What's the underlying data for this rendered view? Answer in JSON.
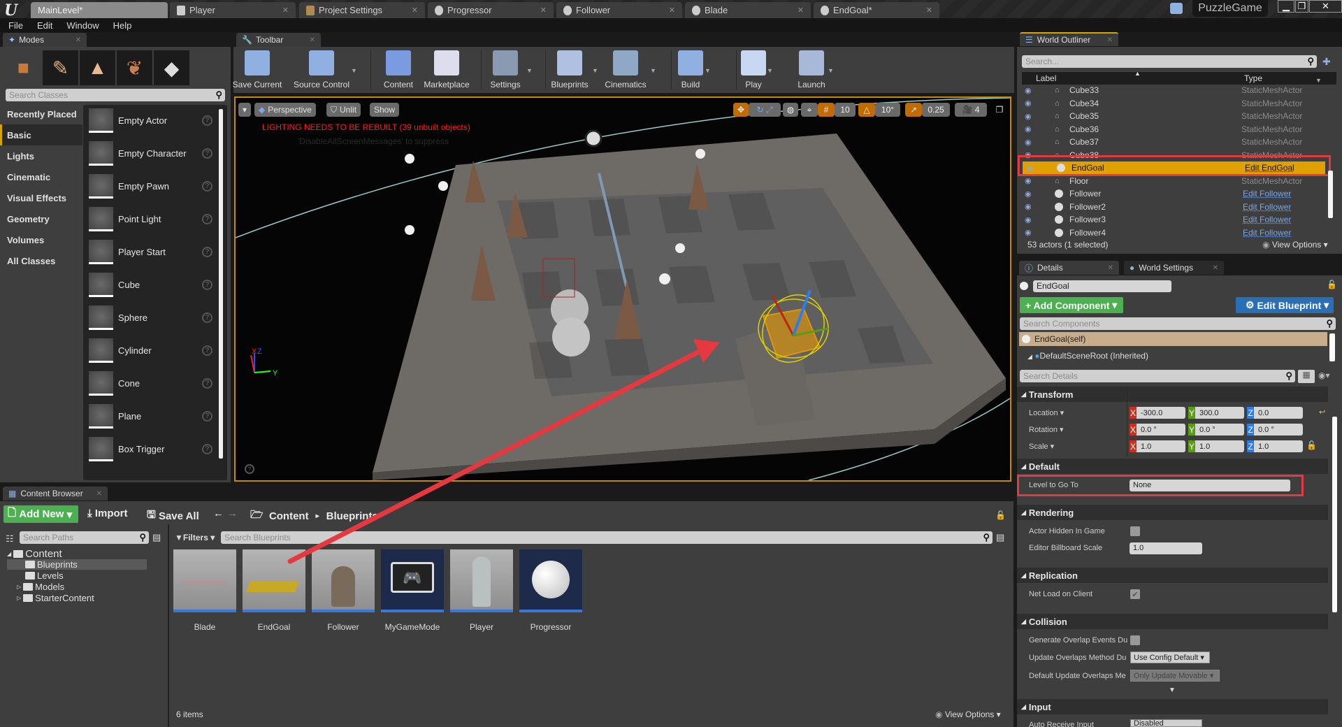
{
  "titlebar": {
    "tabs": [
      {
        "label": "MainLevel*",
        "active": true
      },
      {
        "label": "Player"
      },
      {
        "label": "Project Settings"
      },
      {
        "label": "Progressor"
      },
      {
        "label": "Follower"
      },
      {
        "label": "Blade"
      },
      {
        "label": "EndGoal*"
      }
    ],
    "project_name": "PuzzleGame",
    "window_buttons": {
      "minimize": "▁",
      "restore": "❐",
      "close": "✕"
    }
  },
  "menu": [
    "File",
    "Edit",
    "Window",
    "Help"
  ],
  "modes": {
    "tab_label": "Modes",
    "mode_icons": [
      "place-mode-icon",
      "paint-mode-icon",
      "landscape-mode-icon",
      "foliage-mode-icon",
      "geometry-mode-icon"
    ],
    "search_placeholder": "Search Classes",
    "categories": [
      {
        "label": "Recently Placed"
      },
      {
        "label": "Basic",
        "selected": true
      },
      {
        "label": "Lights"
      },
      {
        "label": "Cinematic"
      },
      {
        "label": "Visual Effects"
      },
      {
        "label": "Geometry"
      },
      {
        "label": "Volumes"
      },
      {
        "label": "All Classes"
      }
    ],
    "items": [
      "Empty Actor",
      "Empty Character",
      "Empty Pawn",
      "Point Light",
      "Player Start",
      "Cube",
      "Sphere",
      "Cylinder",
      "Cone",
      "Plane",
      "Box Trigger"
    ],
    "help_glyph": "?"
  },
  "toolbar": {
    "tab_label": "Toolbar",
    "buttons": [
      {
        "label": "Save Current",
        "icon": "save-icon"
      },
      {
        "label": "Source Control",
        "icon": "source-control-icon",
        "dropdown": true
      },
      {
        "label": "Content",
        "icon": "content-icon"
      },
      {
        "label": "Marketplace",
        "icon": "marketplace-icon"
      },
      {
        "label": "Settings",
        "icon": "settings-icon",
        "dropdown": true
      },
      {
        "label": "Blueprints",
        "icon": "blueprints-icon",
        "dropdown": true
      },
      {
        "label": "Cinematics",
        "icon": "cinematics-icon",
        "dropdown": true
      },
      {
        "label": "Build",
        "icon": "build-icon",
        "dropdown": true
      },
      {
        "label": "Play",
        "icon": "play-icon",
        "dropdown": true
      },
      {
        "label": "Launch",
        "icon": "launch-icon",
        "dropdown": true
      }
    ]
  },
  "viewport": {
    "view_mode": "Perspective",
    "lighting_mode": "Unlit",
    "show_label": "Show",
    "grid_snap": "10",
    "rotation_snap": "10°",
    "scale_snap": "0.25",
    "camera_speed": "4",
    "warning": "LIGHTING NEEDS TO BE REBUILT (39 unbuilt objects)",
    "suppress_hint": "'DisableAllScreenMessages' to suppress",
    "axis_labels": {
      "x": "X",
      "y": "Y",
      "z": "Z"
    }
  },
  "outliner": {
    "tab_label": "World Outliner",
    "search_placeholder": "Search...",
    "col_label": "Label",
    "col_type": "Type",
    "rows": [
      {
        "label": "Cube33",
        "type": "StaticMeshActor"
      },
      {
        "label": "Cube34",
        "type": "StaticMeshActor"
      },
      {
        "label": "Cube35",
        "type": "StaticMeshActor"
      },
      {
        "label": "Cube36",
        "type": "StaticMeshActor"
      },
      {
        "label": "Cube37",
        "type": "StaticMeshActor"
      },
      {
        "label": "Cube38",
        "type": "StaticMeshActor"
      },
      {
        "label": "EndGoal",
        "type": "Edit EndGoal",
        "link": true,
        "selected": true
      },
      {
        "label": "Floor",
        "type": "StaticMeshActor"
      },
      {
        "label": "Follower",
        "type": "Edit Follower",
        "link": true
      },
      {
        "label": "Follower2",
        "type": "Edit Follower",
        "link": true
      },
      {
        "label": "Follower3",
        "type": "Edit Follower",
        "link": true
      },
      {
        "label": "Follower4",
        "type": "Edit Follower",
        "link": true
      }
    ],
    "status": "53 actors (1 selected)",
    "view_options": "View Options"
  },
  "details": {
    "tab_label": "Details",
    "tab2_label": "World Settings",
    "actor_name": "EndGoal",
    "add_component": "+ Add Component",
    "edit_blueprint": "Edit Blueprint",
    "search_components_placeholder": "Search Components",
    "components": [
      {
        "label": "EndGoal(self)",
        "selected": true
      },
      {
        "label": "DefaultSceneRoot (Inherited)"
      }
    ],
    "search_details_placeholder": "Search Details",
    "sections": {
      "transform": "Transform",
      "default": "Default",
      "rendering": "Rendering",
      "replication": "Replication",
      "collision": "Collision",
      "input": "Input"
    },
    "transform": {
      "location_label": "Location",
      "rotation_label": "Rotation",
      "scale_label": "Scale",
      "location": {
        "x": "-300.0",
        "y": "300.0",
        "z": "0.0"
      },
      "rotation": {
        "x": "0.0 °",
        "y": "0.0 °",
        "z": "0.0 °"
      },
      "scale": {
        "x": "1.0",
        "y": "1.0",
        "z": "1.0"
      }
    },
    "default": {
      "level_to_go_to_label": "Level to Go To",
      "level_to_go_to_value": "None"
    },
    "rendering": {
      "actor_hidden_label": "Actor Hidden In Game",
      "actor_hidden": false,
      "billboard_scale_label": "Editor Billboard Scale",
      "billboard_scale": "1.0"
    },
    "replication": {
      "net_load_label": "Net Load on Client",
      "net_load": true
    },
    "collision": {
      "gen_overlap_label": "Generate Overlap Events Du",
      "gen_overlap": false,
      "update_method_label": "Update Overlaps Method Du",
      "update_method_value": "Use Config Default",
      "default_update_label": "Default Update Overlaps Me",
      "default_update_value": "Only Update Movable"
    },
    "input": {
      "auto_receive_label": "Auto Receive Input",
      "auto_receive_value": "Disabled"
    }
  },
  "content_browser": {
    "tab_label": "Content Browser",
    "add_new": "Add New",
    "import": "Import",
    "save_all": "Save All",
    "breadcrumb": [
      "Content",
      "Blueprints"
    ],
    "search_paths_placeholder": "Search Paths",
    "filters": "Filters",
    "search_assets_placeholder": "Search Blueprints",
    "tree": [
      {
        "label": "Content",
        "level": 0,
        "expanded": true
      },
      {
        "label": "Blueprints",
        "level": 1,
        "selected": true
      },
      {
        "label": "Levels",
        "level": 1
      },
      {
        "label": "Models",
        "level": 1,
        "collapsed": true
      },
      {
        "label": "StarterContent",
        "level": 1,
        "collapsed": true
      }
    ],
    "assets": [
      "Blade",
      "EndGoal",
      "Follower",
      "MyGameMode",
      "Player",
      "Progressor"
    ],
    "item_count": "6 items",
    "view_options": "View Options"
  },
  "colors": {
    "accent_orange": "#d6a300",
    "selection": "#e0a000",
    "add_green": "#4caf50",
    "edit_blue": "#2a6fb5",
    "annotation_red": "#e5393f",
    "warning_red": "#ff1a1a"
  }
}
